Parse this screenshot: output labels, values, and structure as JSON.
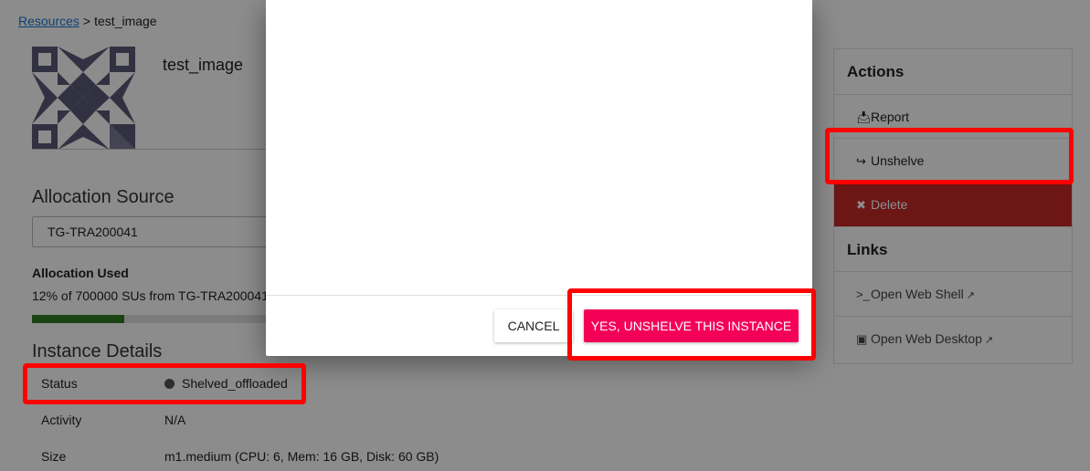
{
  "breadcrumb": {
    "root": "Resources",
    "separator": ">",
    "current": "test_image"
  },
  "instance": {
    "name": "test_image",
    "avatar_icon": "identicon-avatar"
  },
  "allocation": {
    "section_title": "Allocation Source",
    "selected": "TG-TRA200041",
    "used_label": "Allocation Used",
    "used_text": "12% of 700000 SUs from TG-TRA200041",
    "used_percent": 12
  },
  "details": {
    "section_title": "Instance Details",
    "rows": [
      {
        "label": "Status",
        "value": "Shelved_offloaded"
      },
      {
        "label": "Activity",
        "value": "N/A"
      },
      {
        "label": "Size",
        "value": "m1.medium (CPU: 6, Mem: 16 GB, Disk: 60 GB)"
      }
    ]
  },
  "sidebar": {
    "actions_title": "Actions",
    "actions": [
      {
        "label": "Report",
        "icon": "inbox-icon"
      },
      {
        "label": "Unshelve",
        "icon": "sign-in-icon"
      },
      {
        "label": "Delete",
        "icon": "close-icon"
      }
    ],
    "links_title": "Links",
    "links": [
      {
        "label": "Open Web Shell",
        "icon": "terminal-icon"
      },
      {
        "label": "Open Web Desktop",
        "icon": "desktop-icon"
      }
    ]
  },
  "dialog": {
    "cancel_label": "CANCEL",
    "confirm_label": "YES, UNSHELVE THIS INSTANCE"
  },
  "colors": {
    "link": "#1976d2",
    "progress_fill": "#2e7d1f",
    "delete_bg": "#c62828",
    "confirm_bg": "#f50057",
    "highlight": "#ff0000"
  }
}
